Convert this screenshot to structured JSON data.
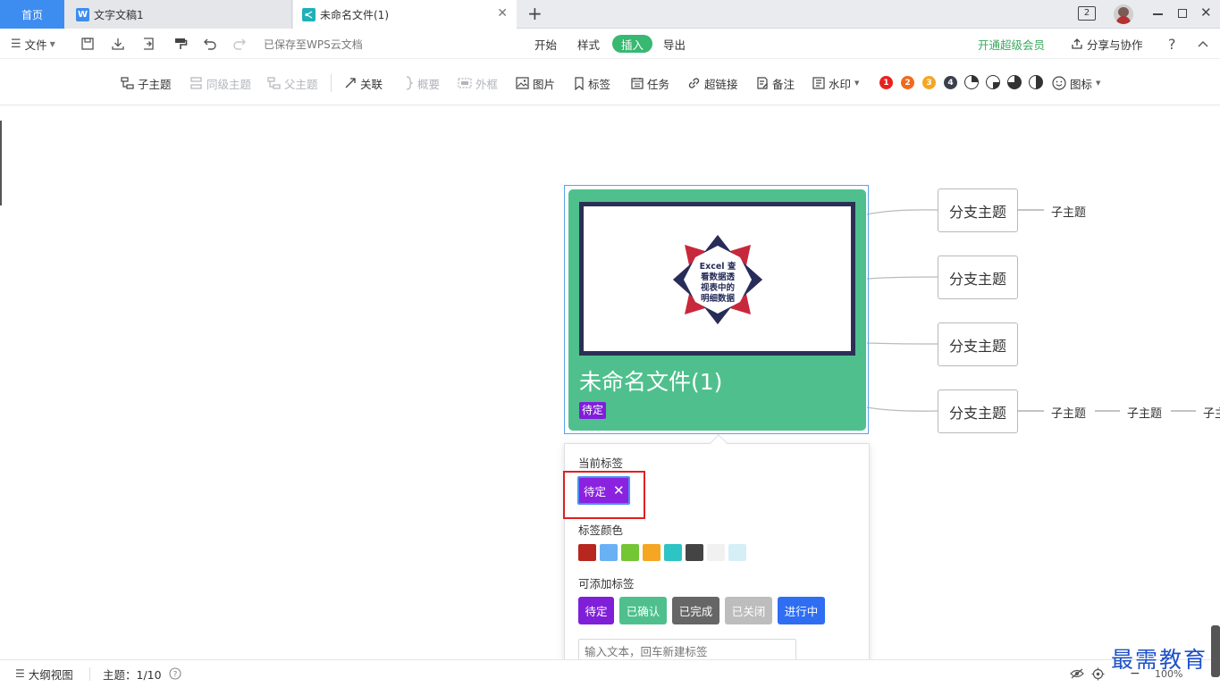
{
  "tabs": {
    "home": "首页",
    "doc": "文字文稿1",
    "mind": "未命名文件(1)",
    "window_count": "2"
  },
  "menubar": {
    "file": "文件",
    "saved_status": "已保存至WPS云文档",
    "start": "开始",
    "style": "样式",
    "insert": "插入",
    "export": "导出",
    "vip": "开通超级会员",
    "share": "分享与协作",
    "help": "?"
  },
  "toolbar": {
    "child_topic": "子主题",
    "sibling_topic": "同级主题",
    "parent_topic": "父主题",
    "relation": "关联",
    "summary": "概要",
    "boundary": "外框",
    "image": "图片",
    "tag": "标签",
    "task": "任务",
    "hyperlink": "超链接",
    "note": "备注",
    "watermark": "水印",
    "icon": "图标",
    "priority": [
      "1",
      "2",
      "3",
      "4"
    ],
    "priority_colors": [
      "#e8211f",
      "#f06a1e",
      "#f5a623",
      "#3a3f4b"
    ]
  },
  "mindmap": {
    "root_title": "未命名文件(1)",
    "root_tag": "待定",
    "image_text": [
      "Excel 查",
      "看数据透",
      "视表中的",
      "明细数据"
    ],
    "branches": [
      "分支主题",
      "分支主题",
      "分支主题",
      "分支主题"
    ],
    "sub_topics_row1": [
      "子主题"
    ],
    "sub_topics_row4": [
      "子主题",
      "子主题",
      "子主题"
    ]
  },
  "tag_panel": {
    "current_label": "当前标签",
    "current_tag": "待定",
    "color_label": "标签颜色",
    "colors": [
      "#b7261f",
      "#6ab0f5",
      "#74c634",
      "#f5a623",
      "#2ec3c4",
      "#444444",
      "#f1f1f1",
      "#d6eef6"
    ],
    "add_label": "可添加标签",
    "available_tags": [
      {
        "label": "待定",
        "color": "#7f1fd8"
      },
      {
        "label": "已确认",
        "color": "#4fc08d"
      },
      {
        "label": "已完成",
        "color": "#666666"
      },
      {
        "label": "已关闭",
        "color": "#bdbdbd"
      },
      {
        "label": "进行中",
        "color": "#2f6ef2"
      }
    ],
    "input_placeholder": "输入文本，回车新建标签"
  },
  "statusbar": {
    "outline_view": "大纲视图",
    "topic_count": "主题：1/10",
    "zoom": "100%"
  },
  "watermark_text": "最需教育"
}
